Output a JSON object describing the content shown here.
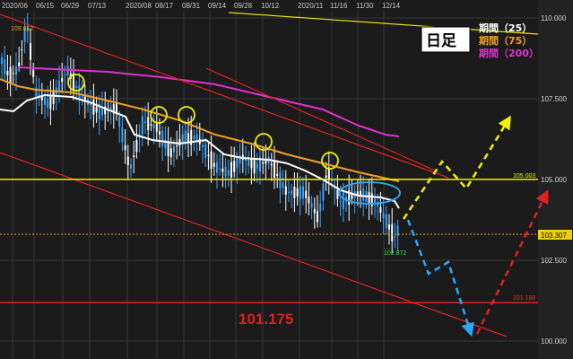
{
  "chart_data": {
    "type": "candlestick",
    "timeframe_label": "日足",
    "x_labels": [
      "2020/06",
      "06/15",
      "06/29",
      "07/13",
      "2020/08",
      "08/17",
      "08/31",
      "09/14",
      "09/28",
      "10/12",
      "2020/11",
      "11/16",
      "11/30",
      "12/14"
    ],
    "y_ticks": [
      "110.000",
      "107.500",
      "105.000",
      "102.500",
      "100.000"
    ],
    "ylim": [
      99.3,
      111.1
    ],
    "legend": [
      {
        "label": "期間（25）",
        "color": "#ffffff"
      },
      {
        "label": "期間（75）",
        "color": "#f0a020"
      },
      {
        "label": "期間（200）",
        "color": "#e030d0"
      }
    ],
    "price_labels": {
      "high_marker": "109.852",
      "low_marker": "102.872",
      "horizontal_line": "105.003",
      "current_price": "103.307",
      "support_small": "101.188",
      "support_big": "101.175"
    },
    "levels": {
      "horizontal_line": 105.003,
      "current_price": 103.307,
      "support": 101.188
    },
    "colors": {
      "background": "#1b1b1b",
      "up_candle": "#ffffff",
      "down_candle": "#3aa3ff",
      "ma25": "#ffffff",
      "ma75": "#f0a020",
      "ma200": "#e030d0",
      "channel": "#e02020",
      "horizontal_line": "#f0f000",
      "current_price_box": "#f0d000",
      "up_scenario": "#f0f000",
      "down_scenario": "#2aa8ff",
      "rebound_scenario": "#e02020",
      "circles": "#f0f000",
      "ellipse": "#2aa8ff"
    }
  }
}
